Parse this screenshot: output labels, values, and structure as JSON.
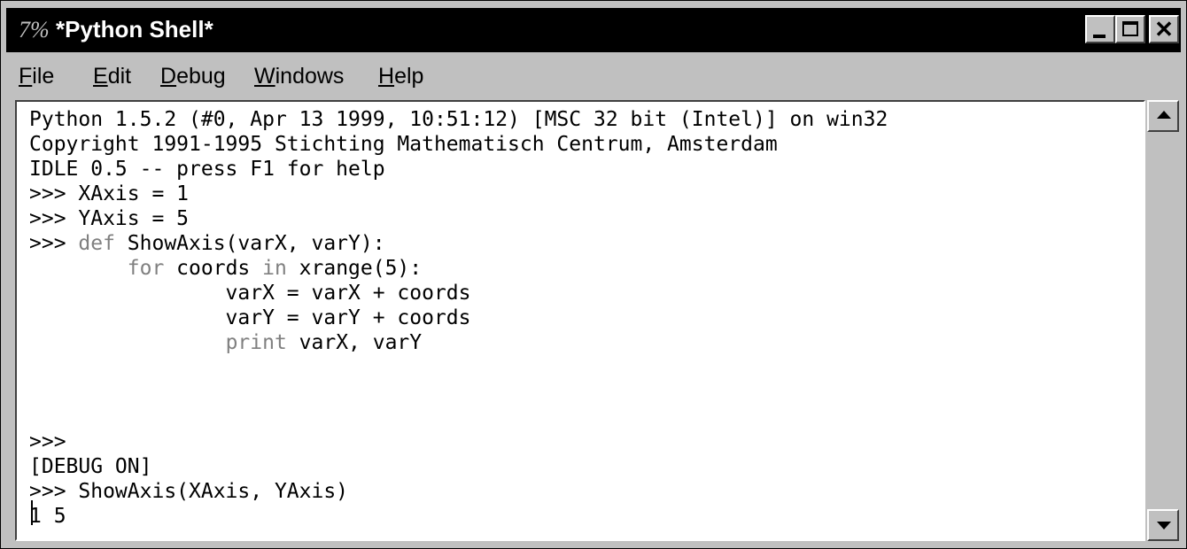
{
  "window": {
    "title": "*Python Shell*",
    "icon": "idle-7%-icon",
    "title_icon_text": "7%"
  },
  "menu": {
    "file": {
      "mnemonic": "F",
      "rest": "ile"
    },
    "edit": {
      "mnemonic": "E",
      "rest": "dit"
    },
    "debug": {
      "mnemonic": "D",
      "rest": "ebug"
    },
    "windows": {
      "mnemonic": "W",
      "rest": "indows"
    },
    "help": {
      "mnemonic": "H",
      "rest": "elp"
    }
  },
  "shell": {
    "l1": "Python 1.5.2 (#0, Apr 13 1999, 10:51:12) [MSC 32 bit (Intel)] on win32",
    "l2": "Copyright 1991-1995 Stichting Mathematisch Centrum, Amsterdam",
    "l3": "IDLE 0.5 -- press F1 for help",
    "l4": ">>> XAxis = 1",
    "l5": ">>> YAxis = 5",
    "l6_prompt": ">>> ",
    "l6_kw": "def",
    "l6_rest": " ShowAxis(varX, varY):",
    "l7_indent": "        ",
    "l7_kw": "for",
    "l7_mid": " coords ",
    "l7_kw2": "in",
    "l7_rest": " xrange(5):",
    "l8": "                varX = varX + coords",
    "l9": "                varY = varY + coords",
    "l10_indent": "                ",
    "l10_kw": "print",
    "l10_rest": " varX, varY",
    "l11": ">>>",
    "l12": "[DEBUG ON]",
    "l13": ">>> ShowAxis(XAxis, YAxis)",
    "l14": "1 5"
  },
  "colors": {
    "titlebar": "#000000",
    "face": "#c0c0c0",
    "keyword": "#808080"
  }
}
